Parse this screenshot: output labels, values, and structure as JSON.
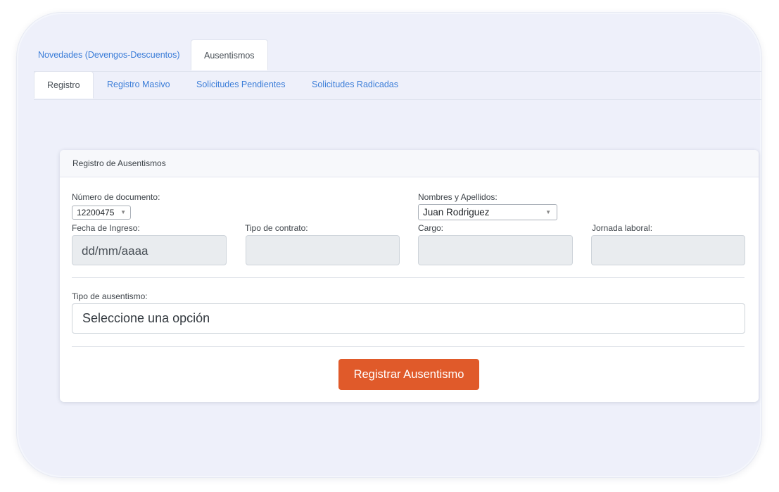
{
  "tabs_primary": [
    {
      "label": "Novedades (Devengos-Descuentos)",
      "active": false
    },
    {
      "label": "Ausentismos",
      "active": true
    }
  ],
  "tabs_secondary": [
    {
      "label": "Registro",
      "active": true
    },
    {
      "label": "Registro Masivo",
      "active": false
    },
    {
      "label": "Solicitudes Pendientes",
      "active": false
    },
    {
      "label": "Solicitudes Radicadas",
      "active": false
    }
  ],
  "card": {
    "title": "Registro de Ausentismos",
    "numero_documento": {
      "label": "Número de documento:",
      "value": "12200475"
    },
    "nombres": {
      "label": "Nombres y Apellidos:",
      "value": "Juan Rodriguez"
    },
    "fecha_ingreso": {
      "label": "Fecha de Ingreso:",
      "value": "dd/mm/aaaa"
    },
    "tipo_contrato": {
      "label": "Tipo de contrato:",
      "value": ""
    },
    "cargo": {
      "label": "Cargo:",
      "value": ""
    },
    "jornada": {
      "label": "Jornada laboral:",
      "value": ""
    },
    "tipo_ausentismo": {
      "label": "Tipo de ausentismo:",
      "value": "Seleccione una opción"
    },
    "submit_label": "Registrar Ausentismo"
  },
  "colors": {
    "accent": "#e05a2a",
    "link": "#3b7dd8",
    "background": "#eef0fa"
  }
}
